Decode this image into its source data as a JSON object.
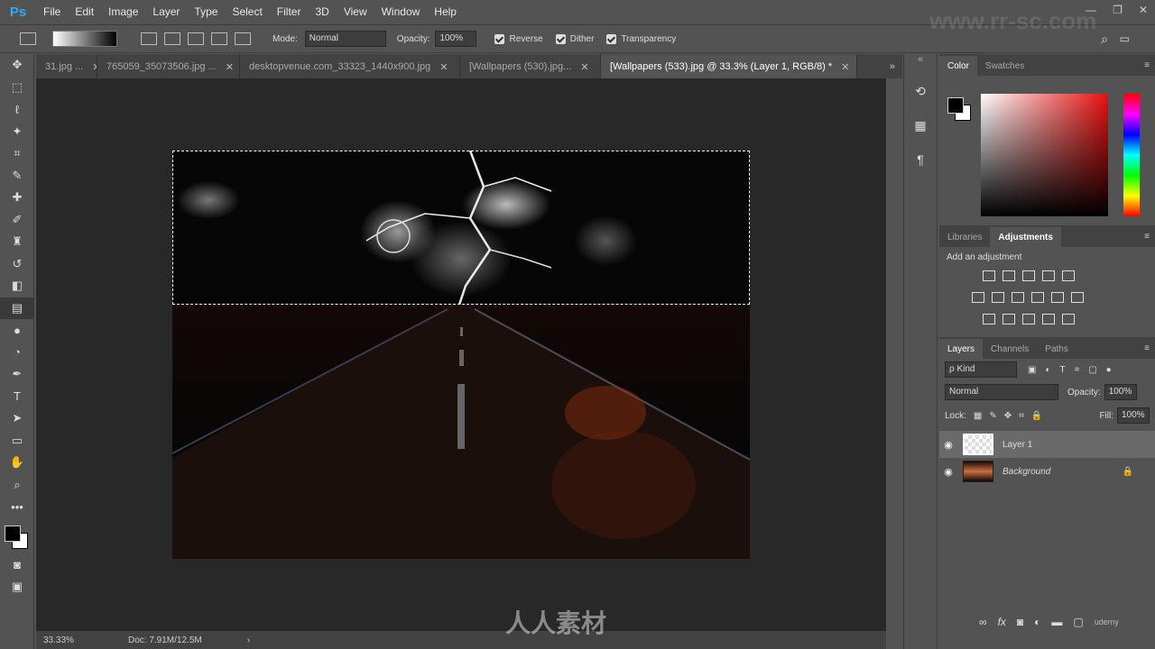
{
  "app": {
    "logo": "Ps",
    "menus": [
      "File",
      "Edit",
      "Image",
      "Layer",
      "Type",
      "Select",
      "Filter",
      "3D",
      "View",
      "Window",
      "Help"
    ],
    "window_controls": [
      "—",
      "❐",
      "✕"
    ]
  },
  "options": {
    "mode_label": "Mode:",
    "mode_value": "Normal",
    "opacity_label": "Opacity:",
    "opacity_value": "100%",
    "reverse": "Reverse",
    "dither": "Dither",
    "transparency": "Transparency"
  },
  "tabs": [
    {
      "label": "31.jpg ..."
    },
    {
      "label": "765059_35073506.jpg ..."
    },
    {
      "label": "desktopvenue.com_33323_1440x900.jpg"
    },
    {
      "label": "[Wallpapers (530).jpg..."
    },
    {
      "label": "[Wallpapers (533).jpg @ 33.3% (Layer 1, RGB/8) *"
    }
  ],
  "tab_close": "✕",
  "status": {
    "zoom": "33.33%",
    "doc": "Doc: 7.91M/12.5M",
    "arrow": "›"
  },
  "color_panel": {
    "tabs": [
      "Color",
      "Swatches"
    ]
  },
  "adjust_panel": {
    "tabs": [
      "Libraries",
      "Adjustments"
    ],
    "heading": "Add an adjustment"
  },
  "layers_panel": {
    "tabs": [
      "Layers",
      "Channels",
      "Paths"
    ],
    "kind": "ρ Kind",
    "blend": "Normal",
    "opacity_label": "Opacity:",
    "opacity_value": "100%",
    "lock_label": "Lock:",
    "fill_label": "Fill:",
    "fill_value": "100%",
    "layers": [
      {
        "name": "Layer 1"
      },
      {
        "name": "Background"
      }
    ]
  },
  "watermark": {
    "site": "www.rr-sc.com",
    "brand": "人人素材",
    "footer_brand": "udemy"
  }
}
